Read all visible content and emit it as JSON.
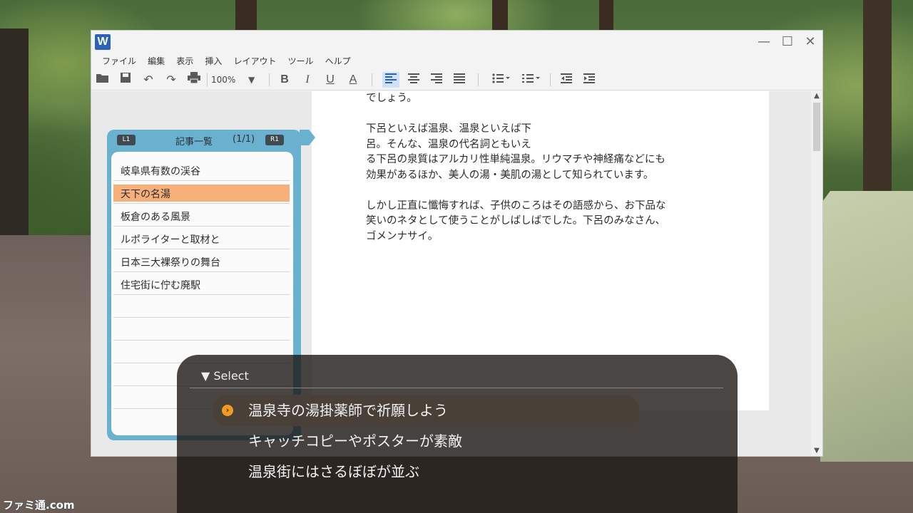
{
  "window": {
    "app_icon_letter": "W",
    "minimize_glyph": "—",
    "maximize_glyph": "☐",
    "close_glyph": "✕"
  },
  "menu": [
    "ファイル",
    "編集",
    "表示",
    "挿入",
    "レイアウト",
    "ツール",
    "ヘルプ"
  ],
  "toolbar": {
    "zoom": "100%",
    "icons": [
      "open-folder-icon",
      "save-icon",
      "undo-icon",
      "redo-icon",
      "print-icon",
      "bold-icon",
      "italic-icon",
      "underline-icon",
      "font-color-icon",
      "align-left-icon",
      "align-center-icon",
      "align-right-icon",
      "justify-icon",
      "bullet-list-icon",
      "numbered-list-icon",
      "outdent-icon",
      "indent-icon"
    ],
    "bold": "B",
    "italic": "I",
    "underline": "U",
    "font_color": "A"
  },
  "document": {
    "lines": [
      "でしょう。",
      "",
      "下呂といえば温泉、温泉といえば下",
      "呂。そんな、温泉の代名詞ともいえ",
      "る下呂の泉質はアルカリ性単純温泉。リウマチや神経痛などにも",
      "効果があるほか、美人の湯・美肌の湯として知られています。",
      "",
      "しかし正直に懺悔すれば、子供のころはその語感から、お下品な",
      "笑いのネタとして使うことがしばしばでした。下呂のみなさん、",
      "ゴメンナサイ。"
    ]
  },
  "article_list": {
    "left_badge": "L1",
    "right_badge": "R1",
    "title": "記事一覧",
    "page": "(1/1)",
    "items": [
      {
        "label": "岐阜県有数の渓谷",
        "selected": false
      },
      {
        "label": "天下の名湯",
        "selected": true
      },
      {
        "label": "板倉のある風景",
        "selected": false
      },
      {
        "label": "ルポライターと取材と",
        "selected": false
      },
      {
        "label": "日本三大裸祭りの舞台",
        "selected": false
      },
      {
        "label": "住宅街に佇む廃駅",
        "selected": false
      }
    ]
  },
  "select": {
    "header": "▼ Select",
    "options": [
      {
        "label": "温泉寺の湯掛薬師で祈願しよう",
        "active": true
      },
      {
        "label": "キャッチコピーやポスターが素敵",
        "active": false
      },
      {
        "label": "温泉街にはさるぼぼが並ぶ",
        "active": false
      }
    ]
  },
  "watermark": "ファミ通.com",
  "colors": {
    "panel_blue": "#6ab0cf",
    "selected_item": "#f8b07a",
    "option_icon": "#f29a21",
    "app_icon": "#2a63b8"
  }
}
